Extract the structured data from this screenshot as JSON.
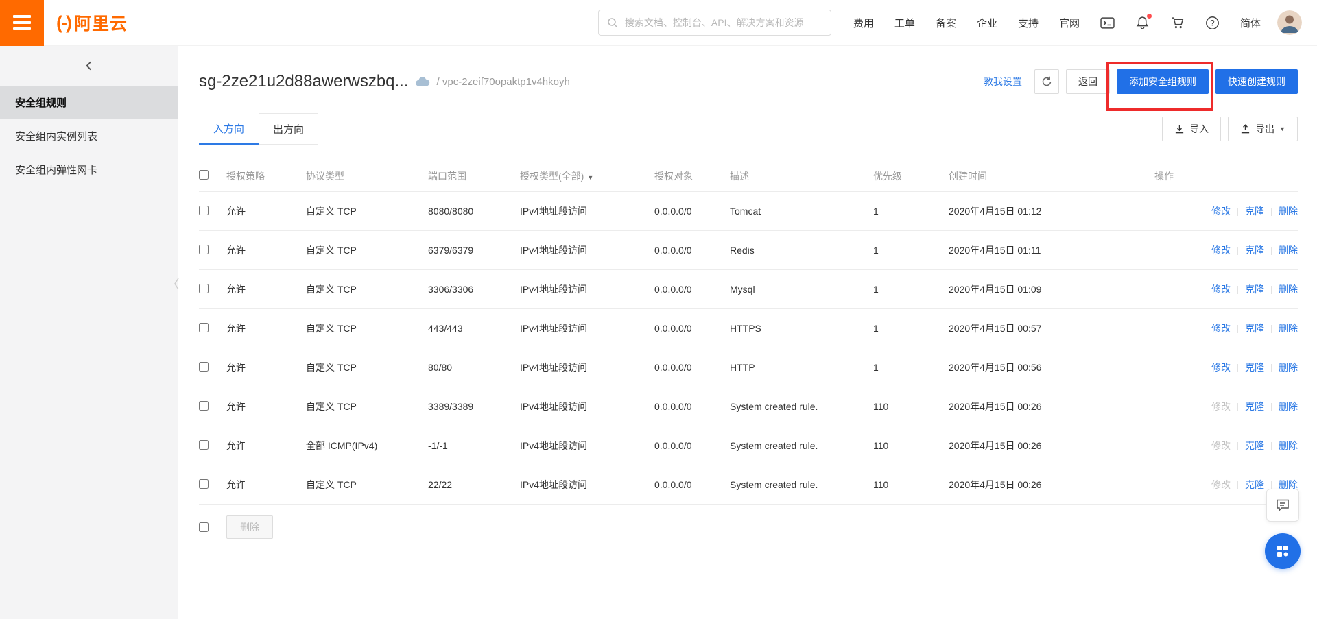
{
  "colors": {
    "brand_orange": "#FF6A00",
    "primary_blue": "#2170E7",
    "link_blue": "#2D7AE5",
    "annotation_red": "#EE2B2B"
  },
  "topbar": {
    "logo_mark": "(-)",
    "logo_text": "阿里云",
    "search": {
      "placeholder": "搜索文档、控制台、API、解决方案和资源"
    },
    "nav": [
      "费用",
      "工单",
      "备案",
      "企业",
      "支持",
      "官网"
    ],
    "locale": "简体"
  },
  "sidebar": {
    "items": [
      {
        "label": "安全组规则"
      },
      {
        "label": "安全组内实例列表"
      },
      {
        "label": "安全组内弹性网卡"
      }
    ]
  },
  "header": {
    "title": "sg-2ze21u2d88awerwszbq...",
    "vpc": "/ vpc-2zeif70opaktp1v4hkoyh",
    "teach_link": "教我设置",
    "back_button": "返回",
    "add_rule_button": "添加安全组规则",
    "quick_create_button": "快速创建规则"
  },
  "tabs": {
    "inbound": "入方向",
    "outbound": "出方向"
  },
  "toolbar": {
    "import": "导入",
    "export": "导出",
    "caret": "▼"
  },
  "table": {
    "headers": {
      "policy": "授权策略",
      "protocol": "协议类型",
      "port": "端口范围",
      "auth_type": "授权类型(全部)",
      "auth_object": "授权对象",
      "description": "描述",
      "priority": "优先级",
      "created": "创建时间",
      "actions": "操作"
    },
    "action_labels": {
      "modify": "修改",
      "clone": "克隆",
      "delete": "删除"
    },
    "rows": [
      {
        "policy": "允许",
        "protocol": "自定义 TCP",
        "port": "8080/8080",
        "auth_type": "IPv4地址段访问",
        "auth_object": "0.0.0.0/0",
        "description": "Tomcat",
        "priority": "1",
        "created": "2020年4月15日 01:12"
      },
      {
        "policy": "允许",
        "protocol": "自定义 TCP",
        "port": "6379/6379",
        "auth_type": "IPv4地址段访问",
        "auth_object": "0.0.0.0/0",
        "description": "Redis",
        "priority": "1",
        "created": "2020年4月15日 01:11"
      },
      {
        "policy": "允许",
        "protocol": "自定义 TCP",
        "port": "3306/3306",
        "auth_type": "IPv4地址段访问",
        "auth_object": "0.0.0.0/0",
        "description": "Mysql",
        "priority": "1",
        "created": "2020年4月15日 01:09"
      },
      {
        "policy": "允许",
        "protocol": "自定义 TCP",
        "port": "443/443",
        "auth_type": "IPv4地址段访问",
        "auth_object": "0.0.0.0/0",
        "description": "HTTPS",
        "priority": "1",
        "created": "2020年4月15日 00:57"
      },
      {
        "policy": "允许",
        "protocol": "自定义 TCP",
        "port": "80/80",
        "auth_type": "IPv4地址段访问",
        "auth_object": "0.0.0.0/0",
        "description": "HTTP",
        "priority": "1",
        "created": "2020年4月15日 00:56"
      },
      {
        "policy": "允许",
        "protocol": "自定义 TCP",
        "port": "3389/3389",
        "auth_type": "IPv4地址段访问",
        "auth_object": "0.0.0.0/0",
        "description": "System created rule.",
        "priority": "110",
        "created": "2020年4月15日 00:26"
      },
      {
        "policy": "允许",
        "protocol": "全部 ICMP(IPv4)",
        "port": "-1/-1",
        "auth_type": "IPv4地址段访问",
        "auth_object": "0.0.0.0/0",
        "description": "System created rule.",
        "priority": "110",
        "created": "2020年4月15日 00:26"
      },
      {
        "policy": "允许",
        "protocol": "自定义 TCP",
        "port": "22/22",
        "auth_type": "IPv4地址段访问",
        "auth_object": "0.0.0.0/0",
        "description": "System created rule.",
        "priority": "110",
        "created": "2020年4月15日 00:26"
      }
    ]
  },
  "footer": {
    "delete_button": "删除"
  }
}
